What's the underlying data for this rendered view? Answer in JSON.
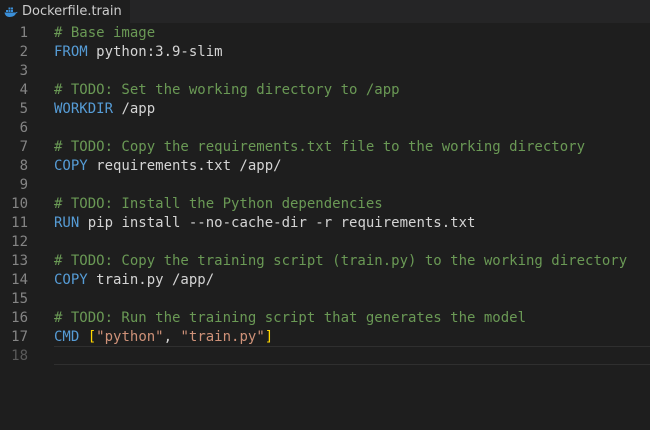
{
  "tab": {
    "filename": "Dockerfile.train",
    "icon": "docker-icon"
  },
  "colors": {
    "background": "#1e1e1e",
    "comment": "#6a9955",
    "keyword": "#569cd6",
    "string": "#ce9178",
    "bracket": "#ffd700",
    "text": "#d4d4d4",
    "line_number": "#858585"
  },
  "editor": {
    "lines": [
      {
        "number": "1",
        "comment": "# Base image"
      },
      {
        "number": "2",
        "keyword": "FROM",
        "text": " python:3.9-slim"
      },
      {
        "number": "3"
      },
      {
        "number": "4",
        "comment": "# TODO: Set the working directory to /app"
      },
      {
        "number": "5",
        "keyword": "WORKDIR",
        "text": " /app"
      },
      {
        "number": "6"
      },
      {
        "number": "7",
        "comment": "# TODO: Copy the requirements.txt file to the working directory"
      },
      {
        "number": "8",
        "keyword": "COPY",
        "text": " requirements.txt /app/"
      },
      {
        "number": "9"
      },
      {
        "number": "10",
        "comment": "# TODO: Install the Python dependencies"
      },
      {
        "number": "11",
        "keyword": "RUN",
        "text": " pip install --no-cache-dir -r requirements.txt"
      },
      {
        "number": "12"
      },
      {
        "number": "13",
        "comment": "# TODO: Copy the training script (train.py) to the working directory"
      },
      {
        "number": "14",
        "keyword": "COPY",
        "text": " train.py /app/"
      },
      {
        "number": "15"
      },
      {
        "number": "16",
        "comment": "# TODO: Run the training script that generates the model"
      },
      {
        "number": "17",
        "keyword": "CMD",
        "open_bracket": "[",
        "string1": "\"python\"",
        "comma": ", ",
        "string2": "\"train.py\"",
        "close_bracket": "]"
      },
      {
        "number": "18"
      }
    ]
  }
}
